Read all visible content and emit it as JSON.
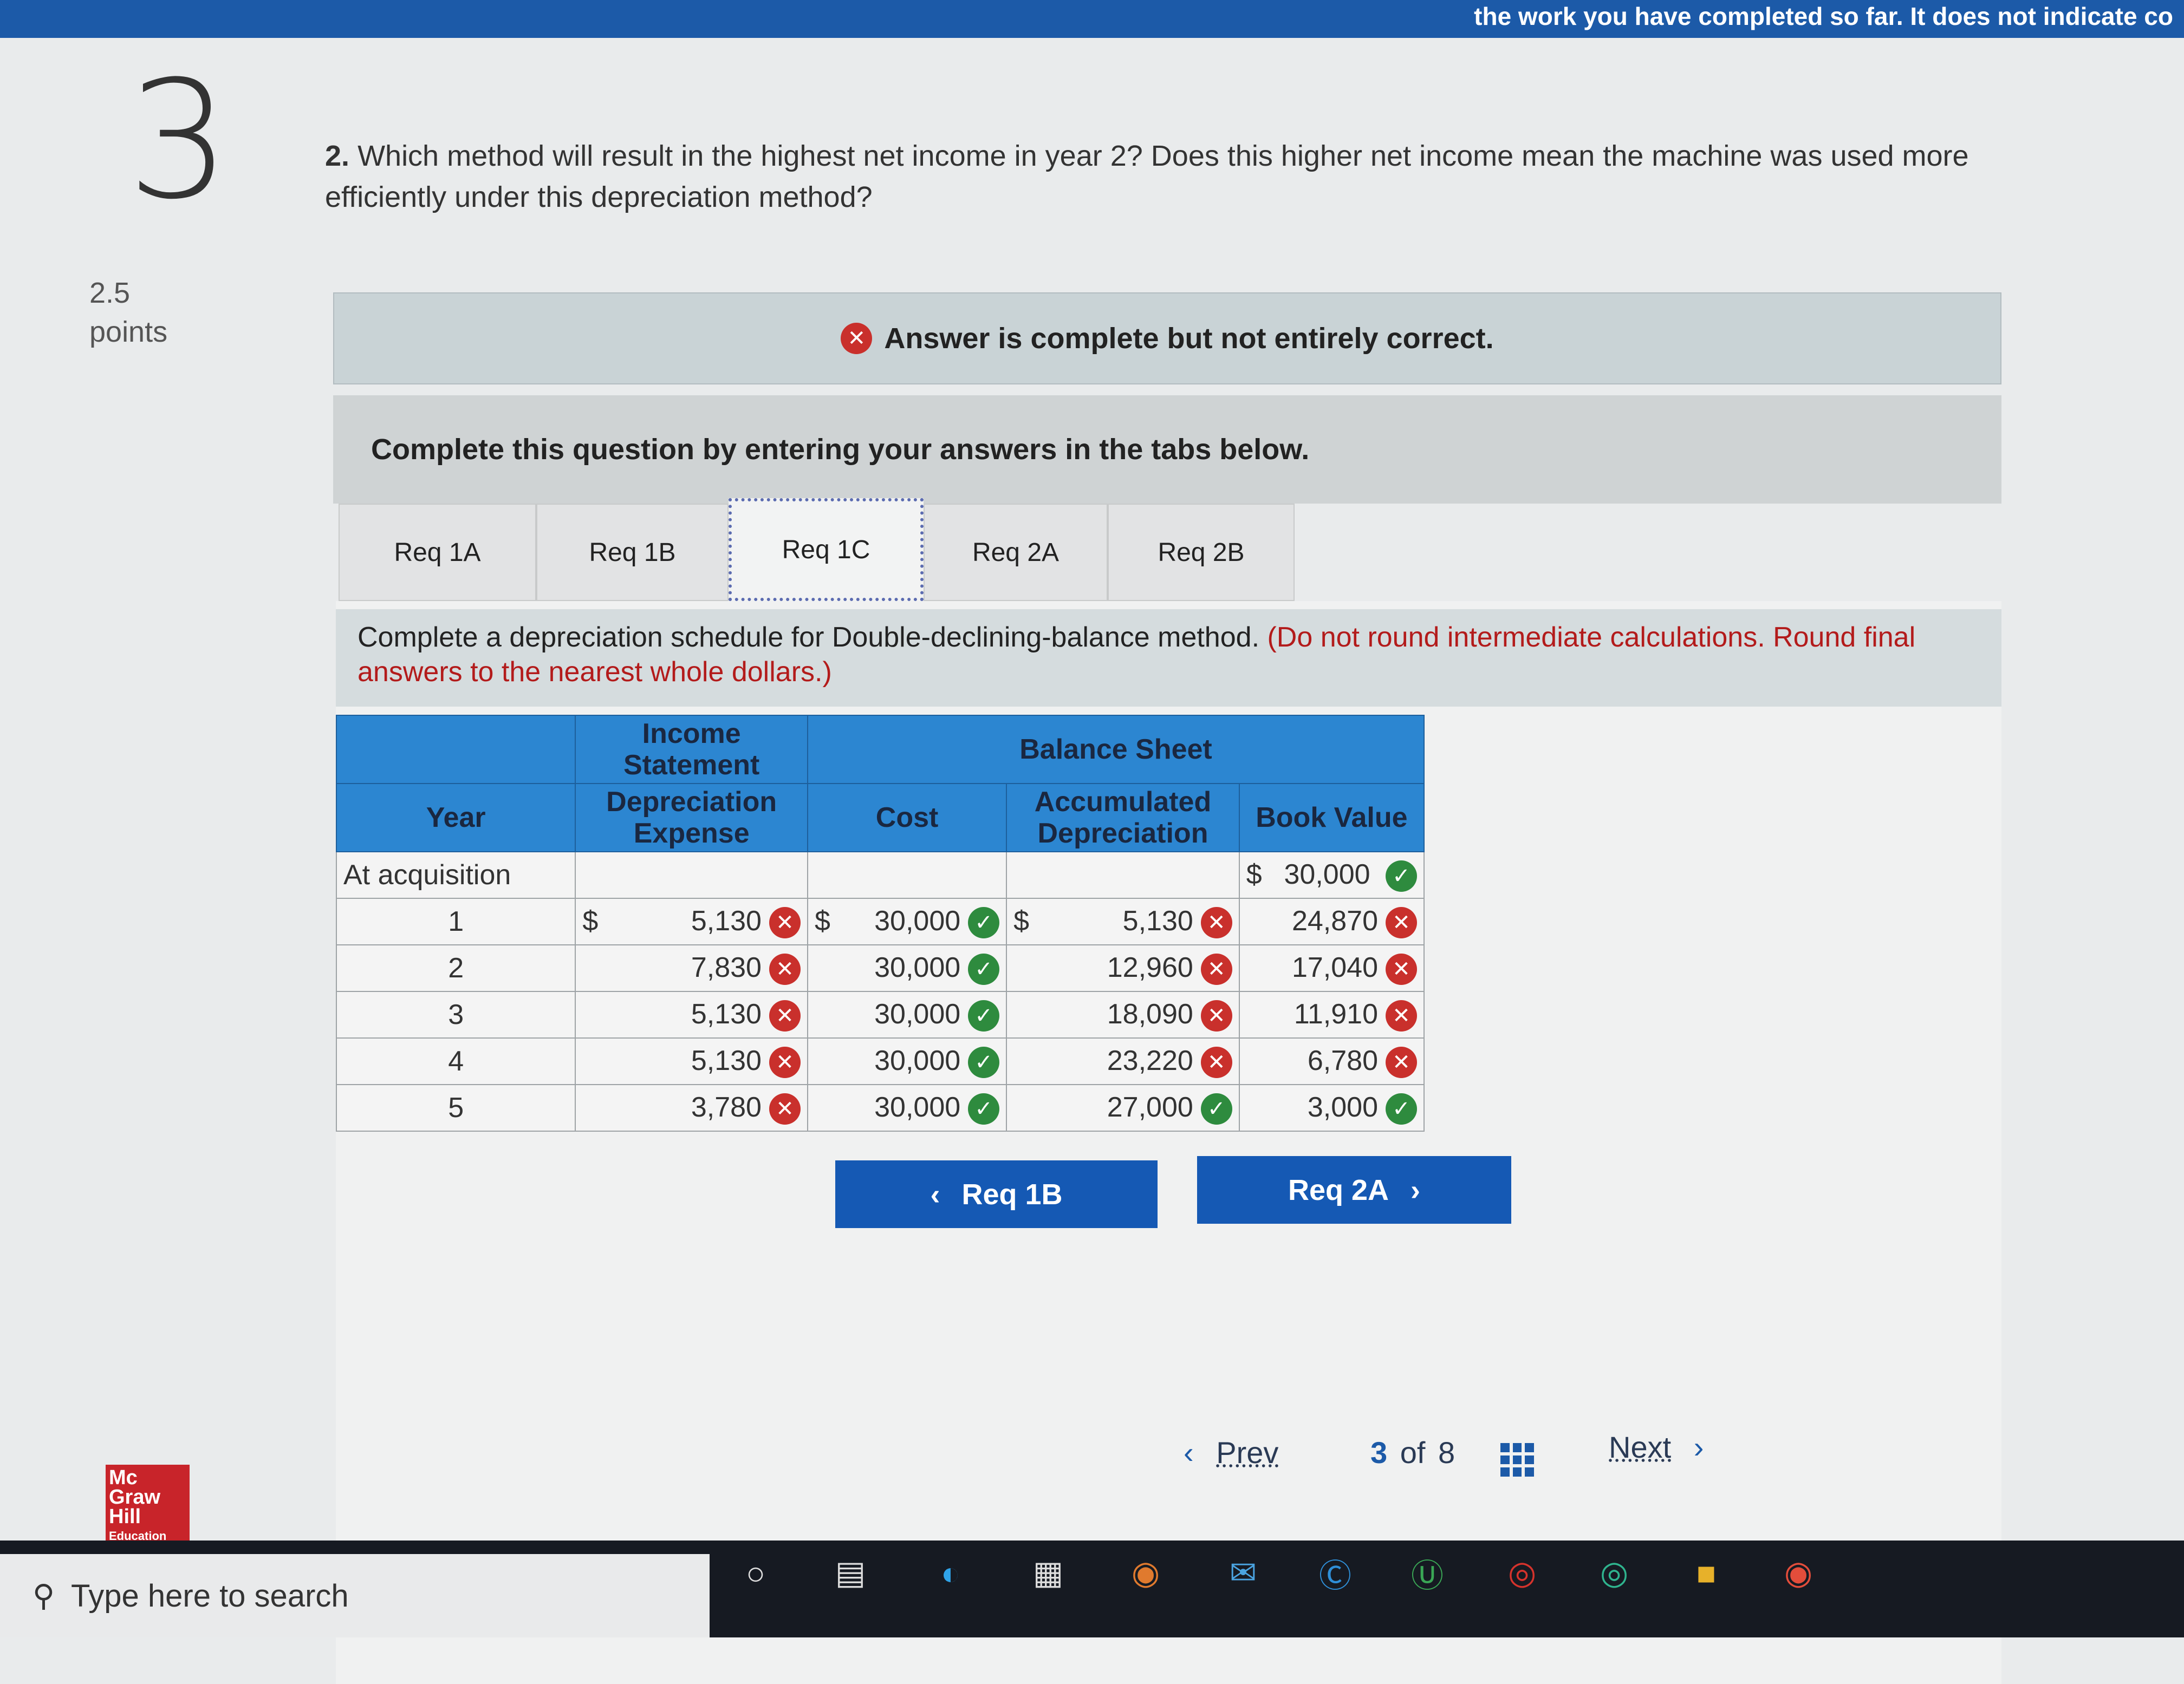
{
  "top_banner": "the work you have completed so far. It does not indicate co",
  "question_number": "3",
  "points": {
    "value": "2.5",
    "label": "points"
  },
  "question": {
    "num": "2.",
    "text": "Which method will result in the highest net income in year 2? Does this higher net income mean the machine was used more efficiently under this depreciation method?"
  },
  "feedback": "Answer is complete but not entirely correct.",
  "instruction": "Complete this question by entering your answers in the tabs below.",
  "tabs": [
    "Req 1A",
    "Req 1B",
    "Req 1C",
    "Req 2A",
    "Req 2B"
  ],
  "active_tab": "Req 1C",
  "prompt": {
    "main": "Complete a depreciation schedule for Double-declining-balance method.",
    "note": "(Do not round intermediate calculations. Round final answers to the nearest whole dollars.)"
  },
  "table": {
    "group_headers": {
      "income": "Income Statement",
      "balance": "Balance Sheet"
    },
    "headers": {
      "year": "Year",
      "dep": "Depreciation Expense",
      "cost": "Cost",
      "accum": "Accumulated Depreciation",
      "book": "Book Value"
    },
    "currency": "$",
    "acq_label": "At acquisition",
    "acq_book": "30,000",
    "rows": [
      {
        "year": "1",
        "dep": "5,130",
        "cost": "30,000",
        "accum": "5,130",
        "book": "24,870"
      },
      {
        "year": "2",
        "dep": "7,830",
        "cost": "30,000",
        "accum": "12,960",
        "book": "17,040"
      },
      {
        "year": "3",
        "dep": "5,130",
        "cost": "30,000",
        "accum": "18,090",
        "book": "11,910"
      },
      {
        "year": "4",
        "dep": "5,130",
        "cost": "30,000",
        "accum": "23,220",
        "book": "6,780"
      },
      {
        "year": "5",
        "dep": "3,780",
        "cost": "30,000",
        "accum": "27,000",
        "book": "3,000"
      }
    ],
    "marks": {
      "correct": "✓",
      "incorrect": "✕"
    }
  },
  "nav": {
    "prev_req": "Req 1B",
    "next_req": "Req 2A"
  },
  "pager": {
    "prev": "Prev",
    "current": "3",
    "of": "of",
    "total": "8",
    "next": "Next"
  },
  "logo": {
    "line1": "Mc",
    "line2": "Graw",
    "line3": "Hill",
    "line4": "Education"
  },
  "taskbar": {
    "search_placeholder": "Type here to search"
  },
  "colors": {
    "header_blue": "#2c86d1",
    "button_blue": "#1559b4",
    "error_red": "#c9302c",
    "ok_green": "#2e8b3e"
  }
}
